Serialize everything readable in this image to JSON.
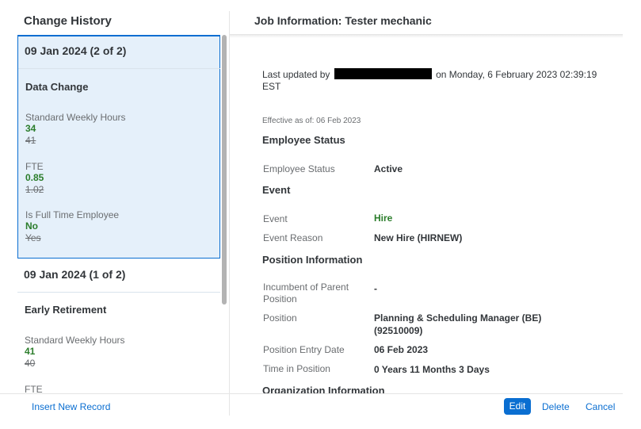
{
  "left_panel": {
    "title": "Change History",
    "records": [
      {
        "date": "09 Jan 2024 (2 of 2)",
        "type": "Data Change",
        "fields": [
          {
            "label": "Standard Weekly Hours",
            "new": "34",
            "old": "41"
          },
          {
            "label": "FTE",
            "new": "0.85",
            "old": "1.02"
          },
          {
            "label": "Is Full Time Employee",
            "new": "No",
            "old": "Yes"
          }
        ]
      },
      {
        "date": "09 Jan 2024 (1 of 2)",
        "type": "Early Retirement",
        "fields": [
          {
            "label": "Standard Weekly Hours",
            "new": "41",
            "old": "40"
          },
          {
            "label": "FTE"
          }
        ]
      }
    ]
  },
  "right_panel": {
    "title": "Job Information: Tester mechanic",
    "updated_prefix": "Last updated by",
    "updated_suffix": "on Monday, 6 February 2023 02:39:19 EST",
    "effective": "Effective as of: 06 Feb 2023",
    "sections": {
      "employee_status": {
        "title": "Employee Status",
        "rows": [
          {
            "label": "Employee Status",
            "value": "Active"
          }
        ]
      },
      "event": {
        "title": "Event",
        "rows": [
          {
            "label": "Event",
            "value": "Hire"
          },
          {
            "label": "Event Reason",
            "value": "New Hire (HIRNEW)"
          }
        ]
      },
      "position": {
        "title": "Position Information",
        "rows": [
          {
            "label": "Incumbent of Parent Position",
            "value": "-"
          },
          {
            "label": "Position",
            "value": "Planning & Scheduling Manager (BE) (92510009)"
          },
          {
            "label": "Position Entry Date",
            "value": "06 Feb 2023"
          },
          {
            "label": "Time in Position",
            "value": "0 Years 11 Months 3 Days"
          }
        ]
      },
      "organization": {
        "title": "Organization Information"
      }
    }
  },
  "footer": {
    "insert_label": "Insert New Record",
    "edit_label": "Edit",
    "delete_label": "Delete",
    "cancel_label": "Cancel"
  },
  "colors": {
    "accent": "#0a6ed1",
    "selected_bg": "#e5f0fa",
    "new_value": "#2b7d2b",
    "redaction": "#000000"
  }
}
